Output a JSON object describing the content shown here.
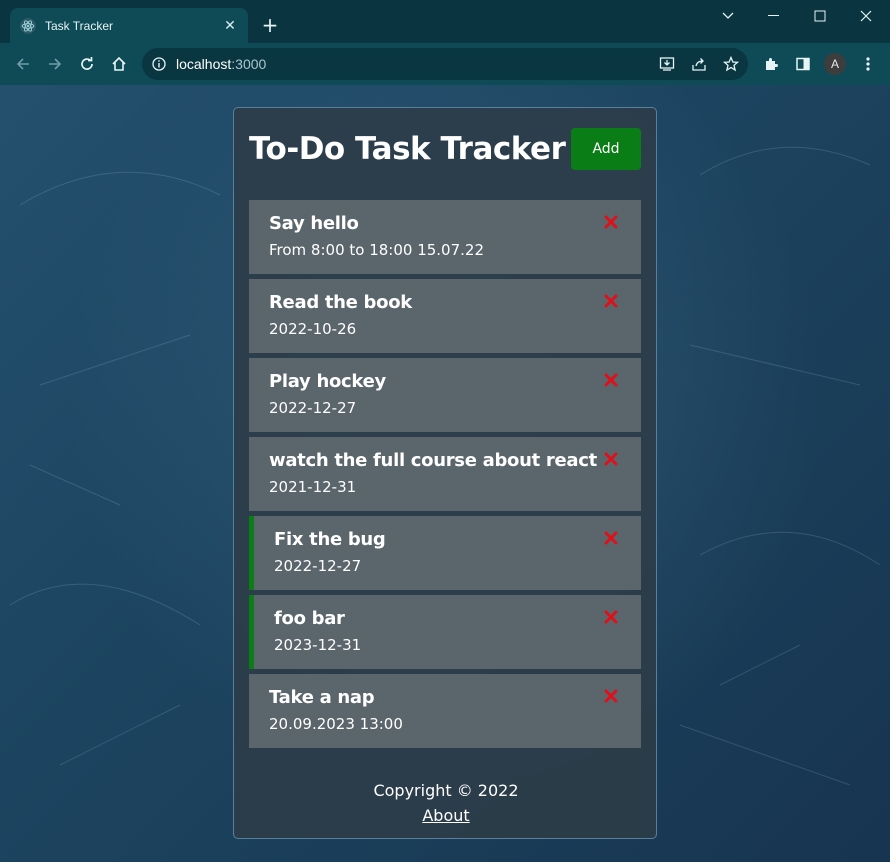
{
  "browser": {
    "tab_title": "Task Tracker",
    "url_host": "localhost",
    "url_port": ":3000",
    "profile_initial": "A"
  },
  "app": {
    "title": "To-Do Task Tracker",
    "add_label": "Add",
    "tasks": [
      {
        "text": "Say hello",
        "day": "From 8:00 to 18:00 15.07.22",
        "reminder": false
      },
      {
        "text": "Read the book",
        "day": "2022-10-26",
        "reminder": false
      },
      {
        "text": "Play hockey",
        "day": "2022-12-27",
        "reminder": false
      },
      {
        "text": "watch the full course about react",
        "day": "2021-12-31",
        "reminder": false
      },
      {
        "text": "Fix the bug",
        "day": "2022-12-27",
        "reminder": true
      },
      {
        "text": "foo bar",
        "day": "2023-12-31",
        "reminder": true
      },
      {
        "text": "Take a nap",
        "day": "20.09.2023 13:00",
        "reminder": false
      }
    ],
    "footer": {
      "copyright": "Copyright © 2022",
      "about_label": "About"
    }
  },
  "colors": {
    "add_button": "#0a7d16",
    "reminder_border": "#0b7d15",
    "delete_icon": "#e0101a",
    "task_bg": "#5b656c"
  }
}
